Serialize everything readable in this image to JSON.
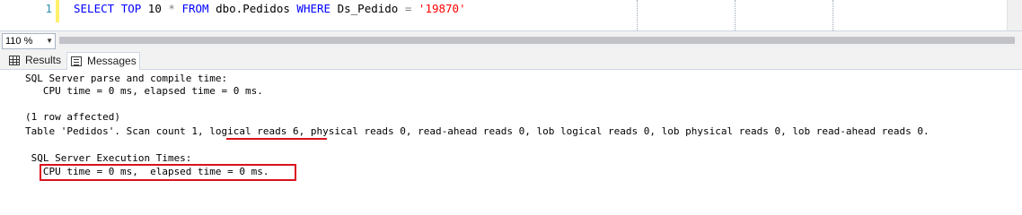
{
  "editor": {
    "line_number": "1",
    "tokens": {
      "select": "SELECT",
      "top": "TOP",
      "count": "10",
      "star": "*",
      "from": "FROM",
      "table": "dbo.Pedidos",
      "where": "WHERE",
      "column": "Ds_Pedido",
      "equals": "=",
      "value": "'19870'"
    }
  },
  "zoom": {
    "value": "110 %"
  },
  "tabs": [
    {
      "label": "Results",
      "icon": "grid-icon",
      "active": false
    },
    {
      "label": "Messages",
      "icon": "message-icon",
      "active": true
    }
  ],
  "messages": {
    "lines": [
      "SQL Server parse and compile time:",
      "   CPU time = 0 ms, elapsed time = 0 ms.",
      "",
      "(1 row affected)",
      "Table 'Pedidos'. Scan count 1, logical reads 6, physical reads 0, read-ahead reads 0, lob logical reads 0, lob physical reads 0, lob read-ahead reads 0.",
      "",
      " SQL Server Execution Times:",
      "   CPU time = 0 ms,  elapsed time = 0 ms."
    ]
  },
  "colors": {
    "keyword": "#0000ff",
    "string": "#ff0000",
    "line_number": "#2b91af",
    "highlight": "#d9121e"
  }
}
